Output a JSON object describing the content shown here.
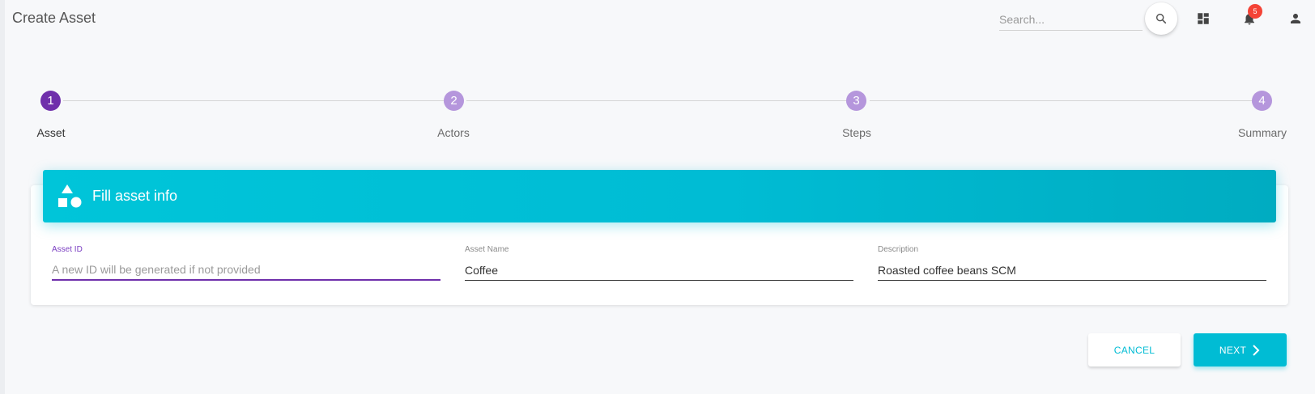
{
  "header": {
    "title": "Create Asset",
    "search_placeholder": "Search...",
    "notifications_count": "5"
  },
  "stepper": {
    "steps": [
      {
        "number": "1",
        "label": "Asset",
        "active": true
      },
      {
        "number": "2",
        "label": "Actors",
        "active": false
      },
      {
        "number": "3",
        "label": "Steps",
        "active": false
      },
      {
        "number": "4",
        "label": "Summary",
        "active": false
      }
    ]
  },
  "card": {
    "title": "Fill asset info",
    "icon": "category-shapes-icon",
    "fields": {
      "asset_id": {
        "label": "Asset ID",
        "value": "",
        "placeholder": "A new ID will be generated if not provided"
      },
      "asset_name": {
        "label": "Asset Name",
        "value": "Coffee",
        "placeholder": ""
      },
      "description": {
        "label": "Description",
        "value": "Roasted coffee beans SCM",
        "placeholder": ""
      }
    }
  },
  "actions": {
    "cancel_label": "CANCEL",
    "next_label": "NEXT"
  },
  "colors": {
    "primary": "#6f2fab",
    "accent": "#00bcd4",
    "badge": "#f44336"
  }
}
